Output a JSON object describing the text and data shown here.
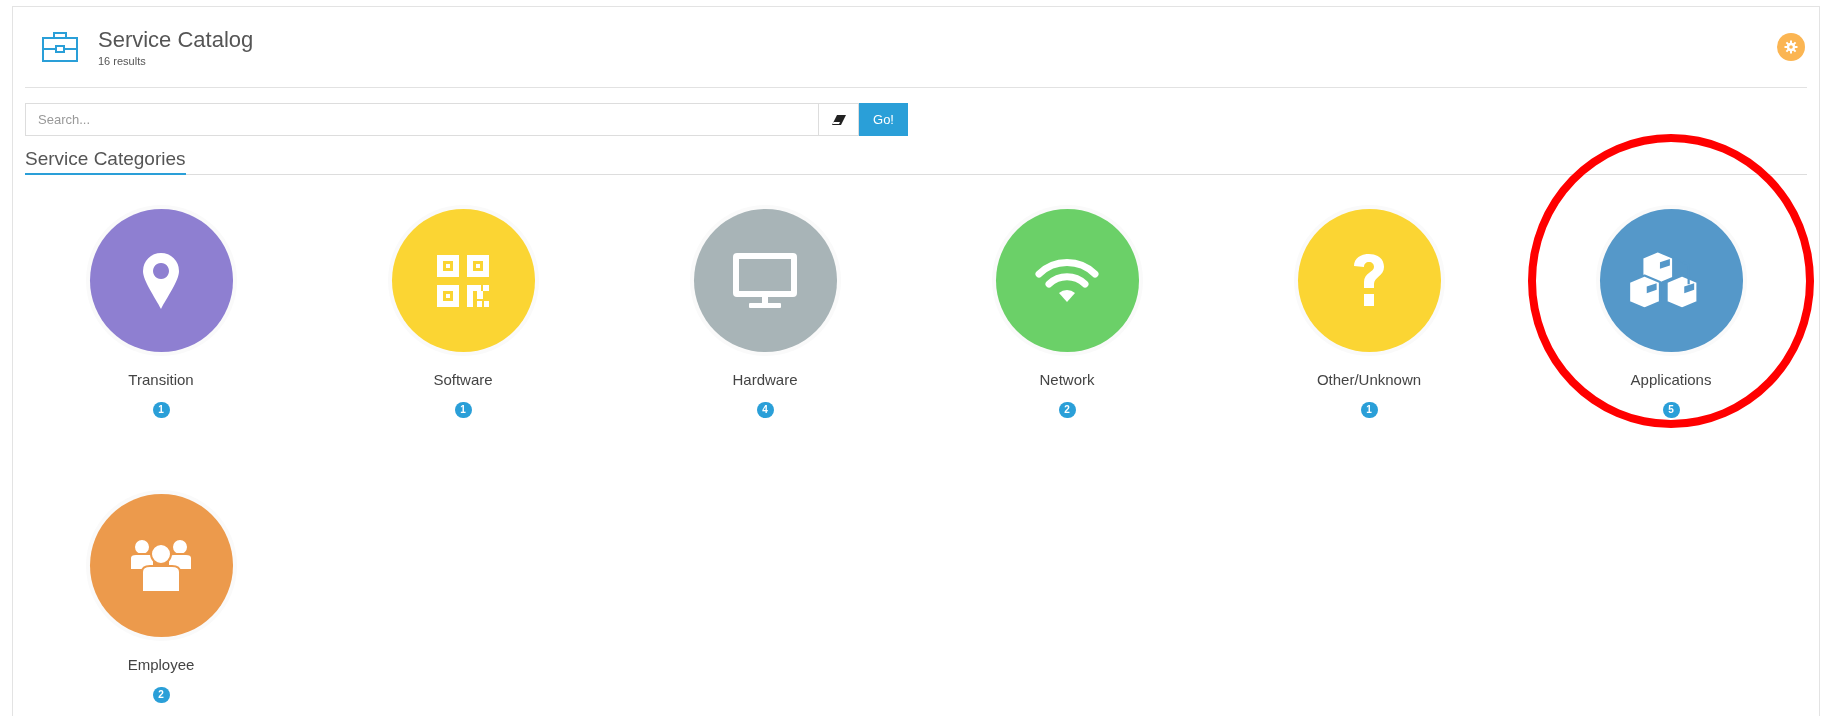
{
  "header": {
    "title": "Service Catalog",
    "subtitle": "16 results"
  },
  "search": {
    "placeholder": "Search...",
    "button": "Go!"
  },
  "section_title": "Service Categories",
  "categories": [
    {
      "label": "Transition",
      "count": "1",
      "kind": "pin",
      "color": "#8e7fd1",
      "highlighted": false
    },
    {
      "label": "Software",
      "count": "1",
      "kind": "qr",
      "color": "#fbd533",
      "highlighted": false
    },
    {
      "label": "Hardware",
      "count": "4",
      "kind": "monitor",
      "color": "#a8b4b7",
      "highlighted": false
    },
    {
      "label": "Network",
      "count": "2",
      "kind": "wifi",
      "color": "#6bd068",
      "highlighted": false
    },
    {
      "label": "Other/Unknown",
      "count": "1",
      "kind": "question",
      "color": "#fbd533",
      "highlighted": false
    },
    {
      "label": "Applications",
      "count": "5",
      "kind": "cubes",
      "color": "#5598c9",
      "highlighted": true
    },
    {
      "label": "Employee",
      "count": "2",
      "kind": "users",
      "color": "#ec9a4c",
      "highlighted": false
    }
  ]
}
